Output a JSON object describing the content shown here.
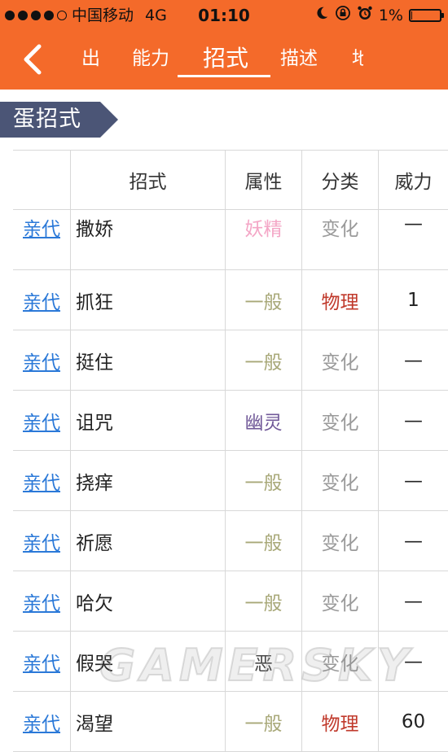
{
  "status_bar": {
    "signal_dots_filled": 4,
    "signal_dots_total": 5,
    "carrier": "中国移动",
    "network": "4G",
    "time": "01:10",
    "battery_text": "1%",
    "battery_level": 0.01,
    "icons": [
      "moon-icon",
      "rotation-lock-icon",
      "alarm-icon"
    ]
  },
  "nav": {
    "tabs": [
      {
        "label": "出",
        "active": false
      },
      {
        "label": "能力",
        "active": false
      },
      {
        "label": "招式",
        "active": true
      },
      {
        "label": "描述",
        "active": false
      },
      {
        "label": "地",
        "active": false
      }
    ]
  },
  "section": {
    "title": "蛋招式"
  },
  "table": {
    "headers": {
      "learn": "",
      "move": "招式",
      "type": "属性",
      "category": "分类",
      "power": "威力"
    },
    "rows": [
      {
        "learn": "亲代",
        "move": "撒娇",
        "type": "妖精",
        "category": "变化",
        "power": "—"
      },
      {
        "learn": "亲代",
        "move": "抓狂",
        "type": "一般",
        "category": "物理",
        "power": "1"
      },
      {
        "learn": "亲代",
        "move": "挺住",
        "type": "一般",
        "category": "变化",
        "power": "—"
      },
      {
        "learn": "亲代",
        "move": "诅咒",
        "type": "幽灵",
        "category": "变化",
        "power": "—"
      },
      {
        "learn": "亲代",
        "move": "挠痒",
        "type": "一般",
        "category": "变化",
        "power": "—"
      },
      {
        "learn": "亲代",
        "move": "祈愿",
        "type": "一般",
        "category": "变化",
        "power": "—"
      },
      {
        "learn": "亲代",
        "move": "哈欠",
        "type": "一般",
        "category": "变化",
        "power": "—"
      },
      {
        "learn": "亲代",
        "move": "假哭",
        "type": "恶",
        "category": "变化",
        "power": "—"
      },
      {
        "learn": "亲代",
        "move": "渴望",
        "type": "一般",
        "category": "物理",
        "power": "60"
      }
    ]
  },
  "watermark": "GAMERSKY",
  "colors": {
    "accent": "#f46a2a",
    "section_flag": "#4b5576",
    "link": "#2b79d8",
    "type_fairy": "#f4a6c6",
    "type_normal": "#a8a878",
    "type_ghost": "#705898",
    "type_dark": "#4a4a4a",
    "cat_physical": "#c0392b",
    "cat_status": "#9a9a9a"
  }
}
